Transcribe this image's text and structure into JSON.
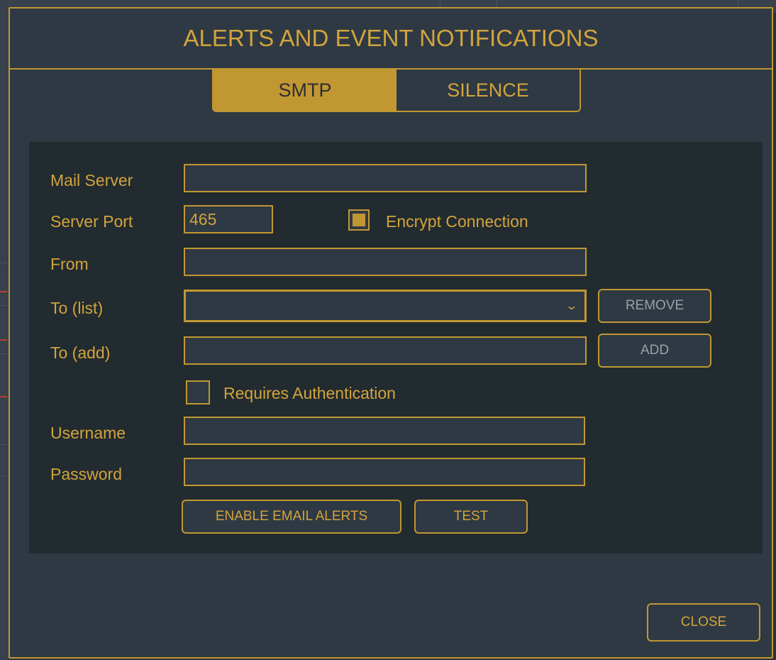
{
  "dialog": {
    "title": "ALERTS AND EVENT NOTIFICATIONS",
    "tabs": [
      {
        "label": "SMTP",
        "active": true
      },
      {
        "label": "SILENCE",
        "active": false
      }
    ]
  },
  "form": {
    "mail_server": {
      "label": "Mail Server",
      "value": ""
    },
    "server_port": {
      "label": "Server Port",
      "value": "465"
    },
    "encrypt_connection": {
      "label": "Encrypt Connection",
      "checked": true
    },
    "from": {
      "label": "From",
      "value": ""
    },
    "to_list": {
      "label": "To (list)",
      "value": ""
    },
    "remove_button": "REMOVE",
    "to_add": {
      "label": "To (add)",
      "value": ""
    },
    "add_button": "ADD",
    "requires_auth": {
      "label": "Requires Authentication",
      "checked": false
    },
    "username": {
      "label": "Username",
      "value": ""
    },
    "password": {
      "label": "Password",
      "value": ""
    },
    "enable_email_alerts_button": "ENABLE EMAIL ALERTS",
    "test_button": "TEST"
  },
  "footer": {
    "close_button": "CLOSE"
  },
  "colors": {
    "accent": "#c19732",
    "text": "#d2a43c",
    "dialog_bg": "#2f3943",
    "panel_bg": "#222b2f"
  },
  "icons": {
    "dropdown": "chevron-down-icon"
  }
}
